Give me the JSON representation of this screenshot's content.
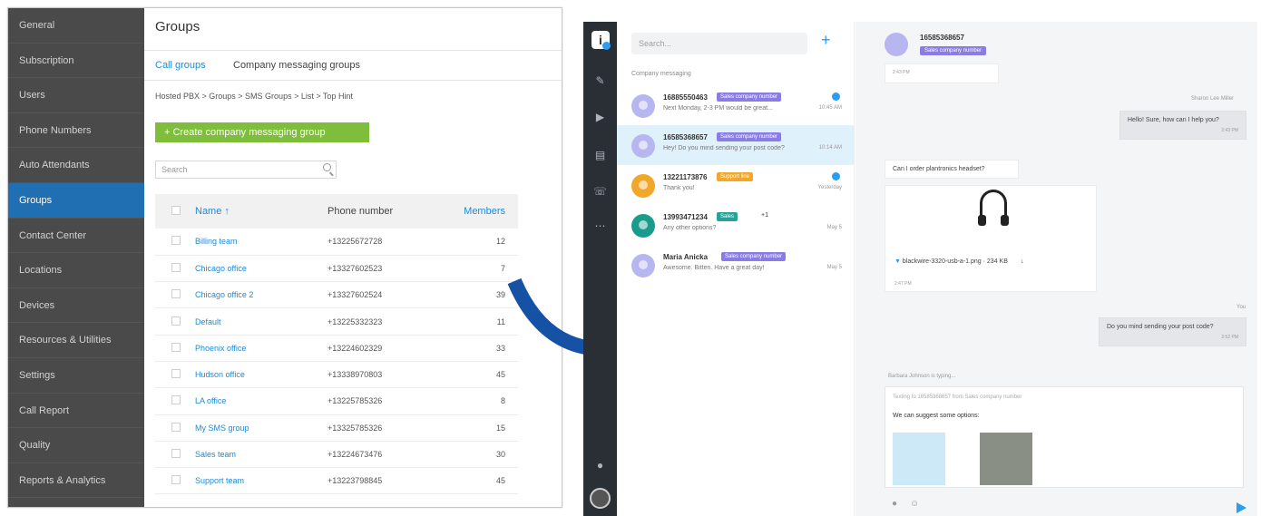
{
  "admin": {
    "nav": [
      "General",
      "Subscription",
      "Users",
      "Phone Numbers",
      "Auto Attendants",
      "Groups",
      "Contact Center",
      "Locations",
      "Devices",
      "Resources & Utilities",
      "Settings",
      "Call Report",
      "Quality",
      "Reports & Analytics"
    ],
    "active_nav": "Groups",
    "title": "Groups",
    "tabs": [
      "Call groups",
      "Company messaging groups"
    ],
    "breadcrumb": "Hosted PBX > Groups > SMS Groups > List > Top Hint",
    "create_label": "+ Create company messaging group",
    "search_placeholder": "Search",
    "table": {
      "headers": [
        "Name ↑",
        "Phone number",
        "Members"
      ],
      "rows": [
        {
          "name": "Billing team",
          "phone": "+13225672728",
          "members": "12"
        },
        {
          "name": "Chicago office",
          "phone": "+13327602523",
          "members": "7"
        },
        {
          "name": "Chicago office 2",
          "phone": "+13327602524",
          "members": "39"
        },
        {
          "name": "Default",
          "phone": "+13225332323",
          "members": "11"
        },
        {
          "name": "Phoenix office",
          "phone": "+13224602329",
          "members": "33"
        },
        {
          "name": "Hudson office",
          "phone": "+13338970803",
          "members": "45"
        },
        {
          "name": "LA office",
          "phone": "+13225785326",
          "members": "8"
        },
        {
          "name": "My SMS group",
          "phone": "+13325785326",
          "members": "15"
        },
        {
          "name": "Sales team",
          "phone": "+13224673476",
          "members": "30"
        },
        {
          "name": "Support team",
          "phone": "+13223798845",
          "members": "45"
        }
      ]
    }
  },
  "messaging": {
    "search_placeholder": "Search...",
    "section_label": "Company messaging",
    "conversations": [
      {
        "name": "16885550463",
        "tag": "Sales company number",
        "tag_color": "#8b7be6",
        "snippet": "Next Monday, 2-3 PM would be great...",
        "time": "10:45 AM",
        "unread": true,
        "av_color": "#b8b6f0"
      },
      {
        "name": "16585368657",
        "tag": "Sales company number",
        "tag_color": "#8b7be6",
        "snippet": "Hey! Do you mind sending your post code?",
        "time": "10:14 AM",
        "unread": false,
        "av_color": "#b8b6f0",
        "selected": true
      },
      {
        "name": "13221173876",
        "tag": "Support line",
        "tag_color": "#f0a72a",
        "snippet": "Thank you!",
        "time": "Yesterday",
        "unread": true,
        "av_color": "#f0a72a"
      },
      {
        "name": "13993471234",
        "tag": "Sales",
        "tag_color": "#2aa198",
        "ext": "+1",
        "snippet": "Any other options?",
        "time": "May 5",
        "unread": false,
        "av_color": "#1a9c8c"
      },
      {
        "name": "Maria Anicka",
        "tag": "Sales company number",
        "tag_color": "#8b7be6",
        "snippet": "Awesome. Bitten. Have a great day!",
        "time": "May 5",
        "unread": false,
        "av_color": "#b8b6f0"
      }
    ],
    "chat": {
      "contact": "16585368657",
      "contact_tag": "Sales company number",
      "msg1_time": "2:43 PM",
      "agent_name": "Sharon Lee Miller",
      "msg2": "Hello! Sure, how can I help you?",
      "msg2_time": "2:43 PM",
      "msg3": "Can I order plantronics headset?",
      "file_name": "blackwire-3320-usb-a-1.png",
      "file_size": "234 KB",
      "msg4_time": "2:47 PM",
      "agent_short": "You",
      "msg5": "Do you mind sending your post code?",
      "msg5_time": "2:52 PM",
      "typing": "Barbara Johnson is typing...",
      "replying": "Texting to 16585368657 from Sales company number",
      "compose_text": "We can suggest some options:"
    }
  }
}
